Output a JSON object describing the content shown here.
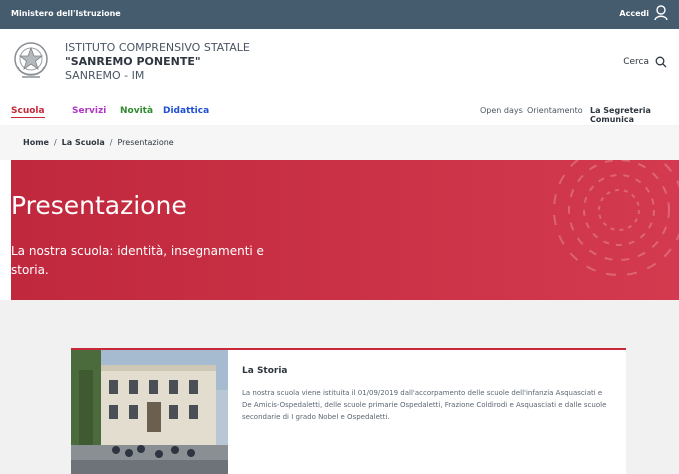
{
  "topbar": {
    "ministry": "Ministero dell'Istruzione",
    "login_label": "Accedi",
    "icon": "user-icon",
    "background": "#455b6e"
  },
  "header": {
    "line1": "ISTITUTO COMPRENSIVO STATALE",
    "line2": "\"SANREMO PONENTE\"",
    "line3": "SANREMO - IM",
    "emblem_icon": "republic-emblem-icon",
    "search_label": "Cerca",
    "search_icon": "search-icon"
  },
  "nav": {
    "main": [
      {
        "label": "Scuola",
        "color": "#c8283a"
      },
      {
        "label": "Servizi",
        "color": "#b237c6"
      },
      {
        "label": "Novità",
        "color": "#2e8b2e"
      },
      {
        "label": "Didattica",
        "color": "#1e4fd4"
      }
    ],
    "secondary": [
      "Open days",
      "Orientamento",
      "La Segreteria Comunica"
    ]
  },
  "breadcrumb": {
    "items": [
      "Home",
      "La Scuola",
      "Presentazione"
    ],
    "separator": "/"
  },
  "hero": {
    "title": "Presentazione",
    "subtitle": "La nostra scuola: identità, insegnamenti e storia.",
    "color": "#c8283a"
  },
  "card": {
    "title": "La Storia",
    "text": "La nostra scuola viene istituita il 01/09/2019 dall'accorpamento delle scuole dell'infanzia Asquasciati e De Amicis-Ospedaletti, delle scuole primarie Ospedaletti, Frazione Coldirodi e Asquasciati e dalle scuole secondarie di I grado Nobel e Ospedaletti.",
    "image": "school-building-photo"
  }
}
